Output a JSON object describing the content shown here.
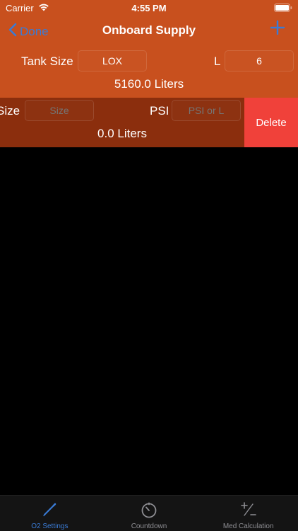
{
  "status_bar": {
    "carrier": "Carrier",
    "time": "4:55 PM"
  },
  "nav": {
    "back_label": "Done",
    "title": "Onboard Supply",
    "add_icon": "plus-icon"
  },
  "rows": [
    {
      "label": "Tank Size",
      "size_value": "LOX",
      "unit_label": "L",
      "amount_value": "6",
      "result": "5160.0 Liters"
    },
    {
      "label": "Size",
      "size_placeholder": "Size",
      "unit_label": "PSI",
      "amount_placeholder": "PSI or L",
      "result": "0.0 Liters",
      "delete_label": "Delete"
    }
  ],
  "tabs": [
    {
      "label": "O2 Settings",
      "icon": "pencil-icon",
      "active": true
    },
    {
      "label": "Countdown",
      "icon": "timer-icon",
      "active": false
    },
    {
      "label": "Med Calculation",
      "icon": "plus-minus-icon",
      "active": false
    }
  ],
  "colors": {
    "header_orange": "#c8501e",
    "swiped_row": "#8b2e0d",
    "delete_red": "#f0413a",
    "tint_blue": "#3a7bd5",
    "tabbar_bg": "#141414"
  }
}
